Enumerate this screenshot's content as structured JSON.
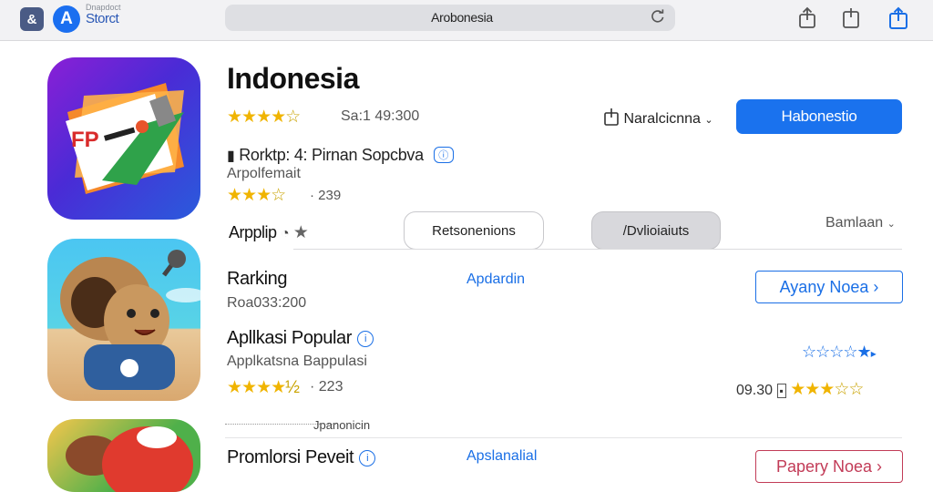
{
  "toolbar": {
    "store_subtitle": "Dnapdoct",
    "store_name": "Storct",
    "address": "Arobonesia",
    "brand_color": "#1a72ee"
  },
  "header": {
    "title": "Indonesia",
    "rating_count": "Sa:1 49:300",
    "share_label": "Naralcicnna",
    "get_button": "Habonestio",
    "ranking_line": "Rorktp: 4: Pirnan Sopcbva",
    "subtitle": "Arpolfemait",
    "rating2_count": "· 239",
    "section_label": "Arpplip"
  },
  "filters": {
    "pill_1": "Retsonenions",
    "pill_2": "/Dvlioiaiuts",
    "sort_label": "Bamlaan"
  },
  "rows": [
    {
      "title": "Rarking",
      "subtitle": "Roa033:200",
      "link": "Apdardin",
      "button": "Ayany Noea ›"
    },
    {
      "title": "Apllkasi Popular",
      "subtitle": "Applkatsna Bappulasi",
      "rating_count": "· 223",
      "price": "09.30"
    },
    {
      "dotted_label": "Jpanonicin",
      "title": "Promlorsi Peveit",
      "link": "Apslanalial",
      "button": "Papery Noea ›"
    }
  ],
  "ratings": {
    "header_stars": 4.5,
    "header2_stars": 3.5,
    "row2_stars": 4.5,
    "row2_blue_stars": 1,
    "row2_price_stars": 3
  },
  "colors": {
    "link": "#1a6fe6",
    "star": "#f0b400",
    "alert_button": "#c23b57"
  }
}
